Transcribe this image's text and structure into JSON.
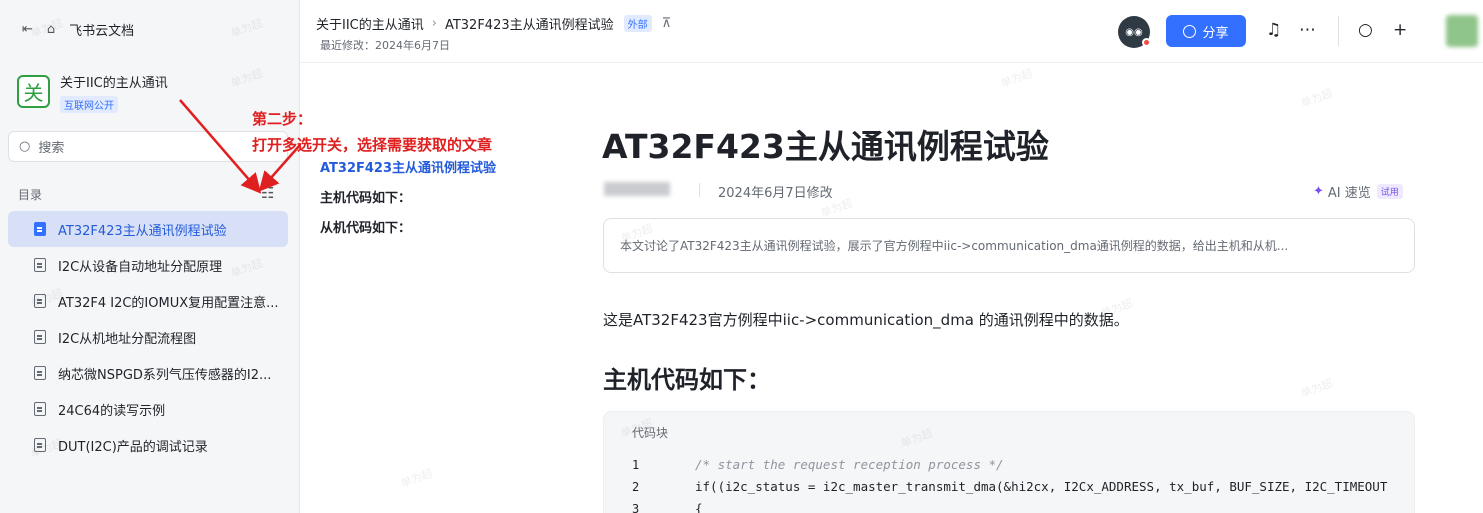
{
  "sidebar": {
    "app_name": "飞书云文档",
    "space_icon_char": "关",
    "space_title": "关于IIC的主从通讯",
    "space_tag": "互联网公开",
    "search_placeholder": "搜索",
    "toc_header": "目录",
    "items": [
      {
        "label": "AT32F423主从通讯例程试验",
        "active": true
      },
      {
        "label": "I2C从设备自动地址分配原理",
        "active": false
      },
      {
        "label": "AT32F4 I2C的IOMUX复用配置注意...",
        "active": false
      },
      {
        "label": "I2C从机地址分配流程图",
        "active": false
      },
      {
        "label": "纳芯微NSPGD系列气压传感器的I2...",
        "active": false
      },
      {
        "label": "24C64的读写示例",
        "active": false
      },
      {
        "label": "DUT(I2C)产品的调试记录",
        "active": false
      }
    ]
  },
  "annotation": {
    "line1": "第二步：",
    "line2": "打开多选开关，选择需要获取的文章",
    "color": "#e02020"
  },
  "header": {
    "breadcrumb_parent": "关于IIC的主从通讯",
    "breadcrumb_current": "AT32F423主从通讯例程试验",
    "external_tag": "外部",
    "last_modified": "最近修改：2024年6月7日",
    "share_label": "分享"
  },
  "outline": [
    "AT32F423主从通讯例程试验",
    "主机代码如下：",
    "从机代码如下："
  ],
  "doc": {
    "title": "AT32F423主从通讯例程试验",
    "modified": "2024年6月7日修改",
    "ai_label": "AI 速览",
    "ai_trial": "试用",
    "summary": "本文讨论了AT32F423主从通讯例程试验，展示了官方例程中iic->communication_dma通讯例程的数据，给出主机和从机...",
    "paragraph": "这是AT32F423官方例程中iic->communication_dma 的通讯例程中的数据。",
    "heading": "主机代码如下：",
    "code_label": "代码块",
    "code_lines": [
      {
        "n": "1",
        "text": "/* start the request reception process */",
        "comment": true
      },
      {
        "n": "2",
        "text": "if((i2c_status = i2c_master_transmit_dma(&hi2cx, I2Cx_ADDRESS, tx_buf, BUF_SIZE, I2C_TIMEOUT",
        "comment": false
      },
      {
        "n": "3",
        "text": "{",
        "comment": false
      }
    ]
  },
  "watermark": "单为超",
  "colors": {
    "accent": "#3370ff",
    "active_bg": "#d8e0f7"
  }
}
